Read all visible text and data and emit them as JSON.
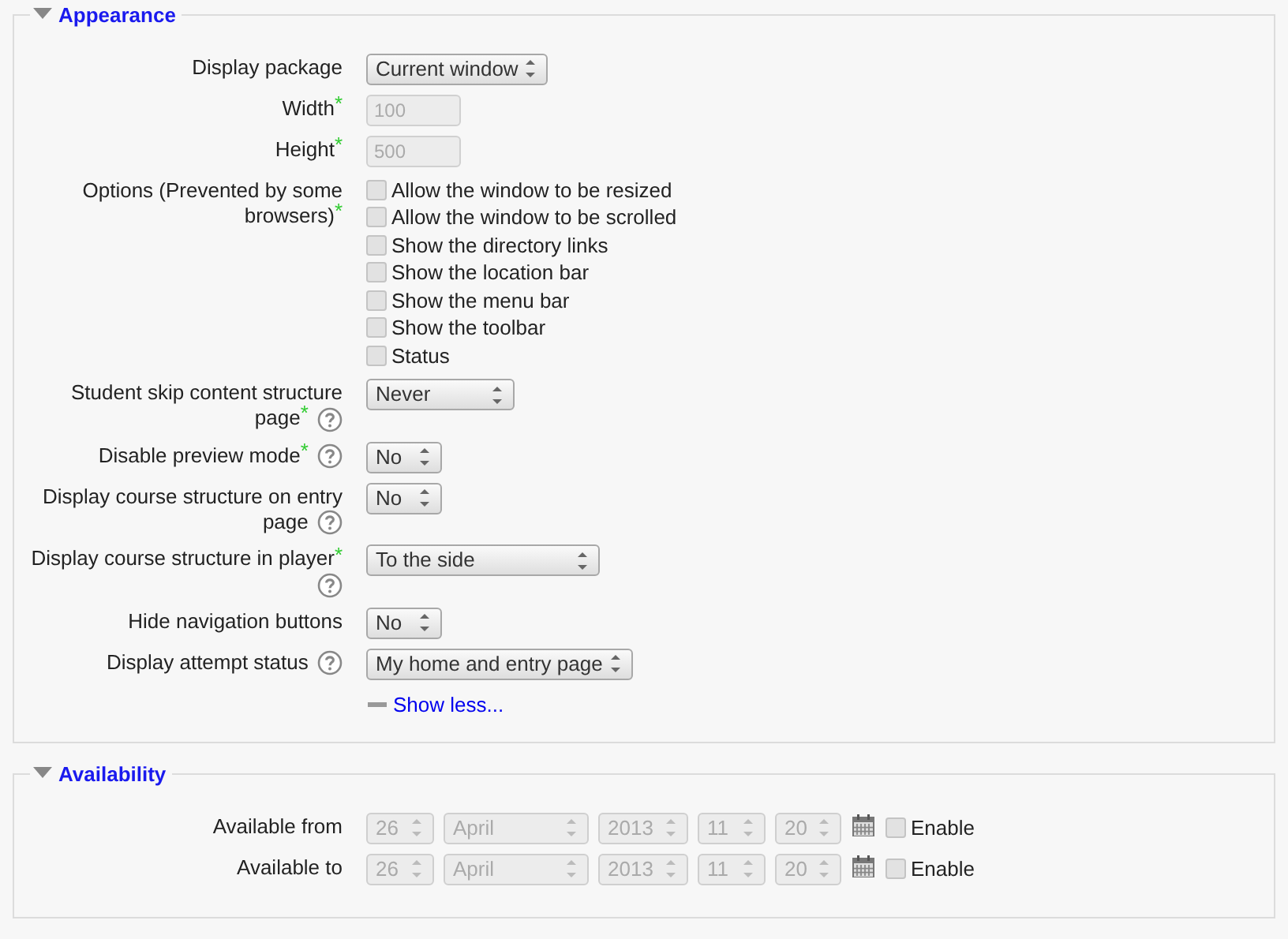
{
  "sections": [
    {
      "title": "Appearance",
      "expanded": true,
      "fields": [
        {
          "kind": "select",
          "label": "Display package",
          "value": "Current window"
        },
        {
          "kind": "text",
          "label": "Width",
          "required_mark": "*",
          "value": "100",
          "disabled": true
        },
        {
          "kind": "text",
          "label": "Height",
          "required_mark": "*",
          "value": "500",
          "disabled": true
        },
        {
          "kind": "checkboxes",
          "label": "Options (Prevented by some browsers)",
          "required_mark": "*",
          "options": [
            {
              "label": "Allow the window to be resized",
              "checked": false
            },
            {
              "label": "Allow the window to be scrolled",
              "checked": false
            },
            {
              "label": "Show the directory links",
              "checked": false
            },
            {
              "label": "Show the location bar",
              "checked": false
            },
            {
              "label": "Show the menu bar",
              "checked": false
            },
            {
              "label": "Show the toolbar",
              "checked": false
            },
            {
              "label": "Status",
              "checked": false
            }
          ]
        },
        {
          "kind": "select",
          "label": "Student skip content structure page",
          "required_mark": "*",
          "help": true,
          "value": "Never"
        },
        {
          "kind": "select",
          "label": "Disable preview mode",
          "required_mark": "*",
          "help": true,
          "value": "No"
        },
        {
          "kind": "select",
          "label": "Display course structure on entry page",
          "help": true,
          "value": "No"
        },
        {
          "kind": "select",
          "label": "Display course structure in player",
          "required_mark": "*",
          "help": true,
          "value": "To the side"
        },
        {
          "kind": "select",
          "label": "Hide navigation buttons",
          "value": "No"
        },
        {
          "kind": "select",
          "label": "Display attempt status",
          "help": true,
          "value": "My home and entry page"
        }
      ],
      "link": "Show less..."
    },
    {
      "title": "Availability",
      "expanded": true,
      "fields": [
        {
          "kind": "date",
          "label": "Available from",
          "parts": [
            "26",
            "April",
            "2013",
            "11",
            "20"
          ],
          "disabled": true,
          "enable": {
            "label": "Enable",
            "checked": false
          }
        },
        {
          "kind": "date",
          "label": "Available to",
          "parts": [
            "26",
            "April",
            "2013",
            "11",
            "20"
          ],
          "disabled": true,
          "enable": {
            "label": "Enable",
            "checked": false
          }
        }
      ]
    }
  ]
}
